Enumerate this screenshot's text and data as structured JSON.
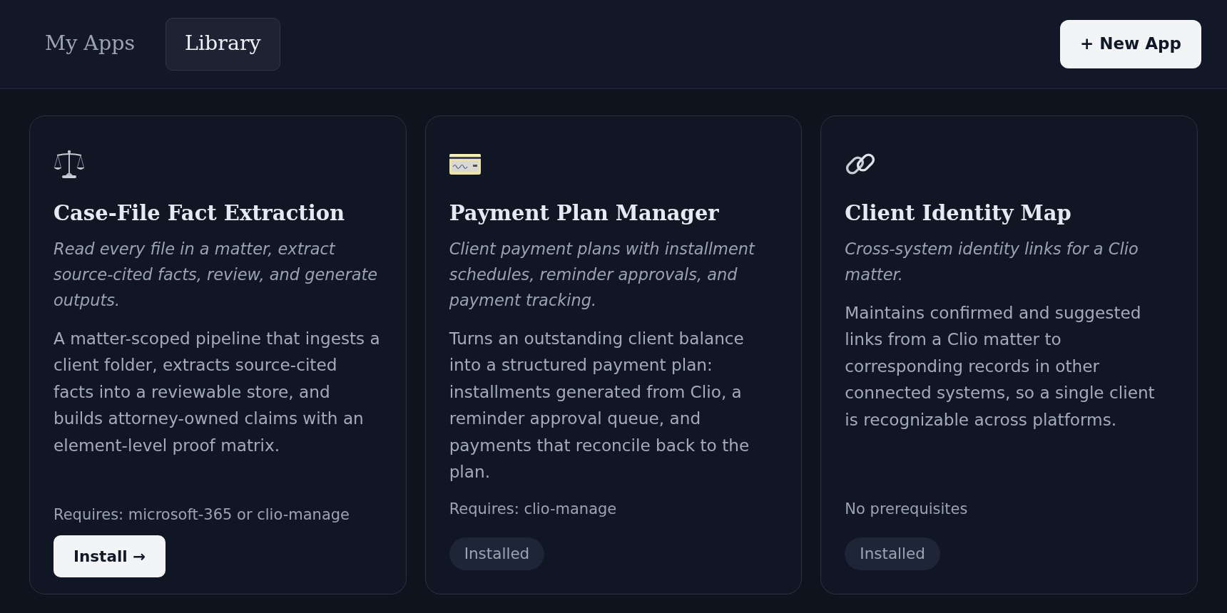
{
  "tabs": [
    {
      "label": "My Apps",
      "selected": false
    },
    {
      "label": "Library",
      "selected": true
    }
  ],
  "new_app_button": {
    "label": "+ New App"
  },
  "apps": [
    {
      "title": "Case-File Fact Extraction",
      "tagline": "Read every file in a matter, extract source-cited facts, review, and generate outputs.",
      "description": "A matter-scoped pipeline that ingests a client folder, extracts source-cited facts into a reviewable store, and builds attorney-owned claims with an element-level proof matrix.",
      "requirements": "Requires: microsoft-365 or clio-manage",
      "installed": false,
      "action": "Install →"
    },
    {
      "title": "Payment Plan Manager",
      "tagline": "Client payment plans with installment schedules, reminder approvals, and payment tracking.",
      "description": "Turns an outstanding client balance into a structured payment plan: installments generated from Clio, a reminder approval queue, and payments that reconcile back to the plan.",
      "requirements": "Requires: clio-manage",
      "installed": true,
      "action": "Installed"
    },
    {
      "title": "Client Identity Map",
      "tagline": "Cross-system identity links for a Clio matter.",
      "description": "Maintains confirmed and suggested links from a Clio matter to corresponding records in other connected systems, so a single client is recognizable across platforms.",
      "requirements": "No prerequisites",
      "installed": true,
      "action": "Installed"
    }
  ]
}
